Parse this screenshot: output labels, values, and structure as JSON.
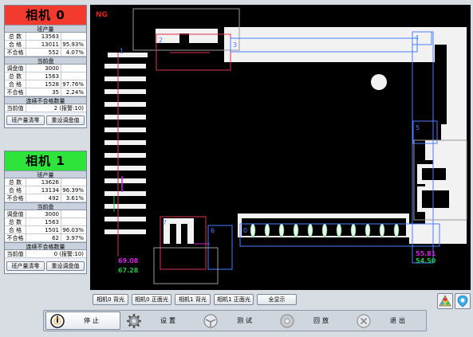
{
  "cameras": [
    {
      "title": "相机 0",
      "shift": {
        "header": "班产量",
        "rows": [
          {
            "label": "总  数",
            "value": "13563",
            "pct": ""
          },
          {
            "label": "合  格",
            "value": "13011",
            "pct": "95.93%"
          },
          {
            "label": "不合格",
            "value": "552",
            "pct": "4.07%"
          }
        ]
      },
      "tray": {
        "header": "当前盘",
        "rows": [
          {
            "label": "调盘值",
            "value": "3000",
            "pct": ""
          },
          {
            "label": "总  数",
            "value": "1563",
            "pct": ""
          },
          {
            "label": "合  格",
            "value": "1528",
            "pct": "97.76%"
          },
          {
            "label": "不合格",
            "value": "35",
            "pct": "2.24%"
          }
        ]
      },
      "consec": {
        "header": "连续不合格数量",
        "label": "当前值",
        "value": "2  (报警:10)"
      },
      "buttons": {
        "reset_shift": "班产量清零",
        "reset_tray": "重设调盘值"
      }
    },
    {
      "title": "相机 1",
      "shift": {
        "header": "班产量",
        "rows": [
          {
            "label": "总  数",
            "value": "13626",
            "pct": ""
          },
          {
            "label": "合  格",
            "value": "13134",
            "pct": "96.39%"
          },
          {
            "label": "不合格",
            "value": "492",
            "pct": "3.61%"
          }
        ]
      },
      "tray": {
        "header": "当前盘",
        "rows": [
          {
            "label": "调盘值",
            "value": "3000",
            "pct": ""
          },
          {
            "label": "总  数",
            "value": "1563",
            "pct": ""
          },
          {
            "label": "合  格",
            "value": "1501",
            "pct": "96.03%"
          },
          {
            "label": "不合格",
            "value": "62",
            "pct": "3.97%"
          }
        ]
      },
      "consec": {
        "header": "连续不合格数量",
        "label": "当前值",
        "value": "0  (报警:10)"
      },
      "buttons": {
        "reset_shift": "班产量清零",
        "reset_tray": "重设调盘值"
      }
    }
  ],
  "viewport": {
    "status": "NG",
    "status_color": "#e02020",
    "roi_labels": [
      "0",
      "1",
      "2",
      "3",
      "4",
      "5",
      "6",
      "7"
    ],
    "measurements": {
      "left_top": "69.08",
      "left_bottom": "67.28",
      "right_top": "55.81",
      "right_bottom": "54.50"
    }
  },
  "view_buttons": [
    "相机0 背光",
    "相机0 正面光",
    "相机1 背光",
    "相机1 正面光",
    "全显示"
  ],
  "toolbar": {
    "stop": "停止",
    "settings": "设置",
    "test": "测试",
    "playback": "回放",
    "exit": "退出"
  },
  "colors": {
    "cam0_ok": "#f23a2e",
    "cam1_ok": "#2ee33a",
    "roi_blue": "#4a7cff",
    "roi_red": "#e0304a",
    "measure_magenta": "#d020e0",
    "measure_green": "#20c040"
  }
}
